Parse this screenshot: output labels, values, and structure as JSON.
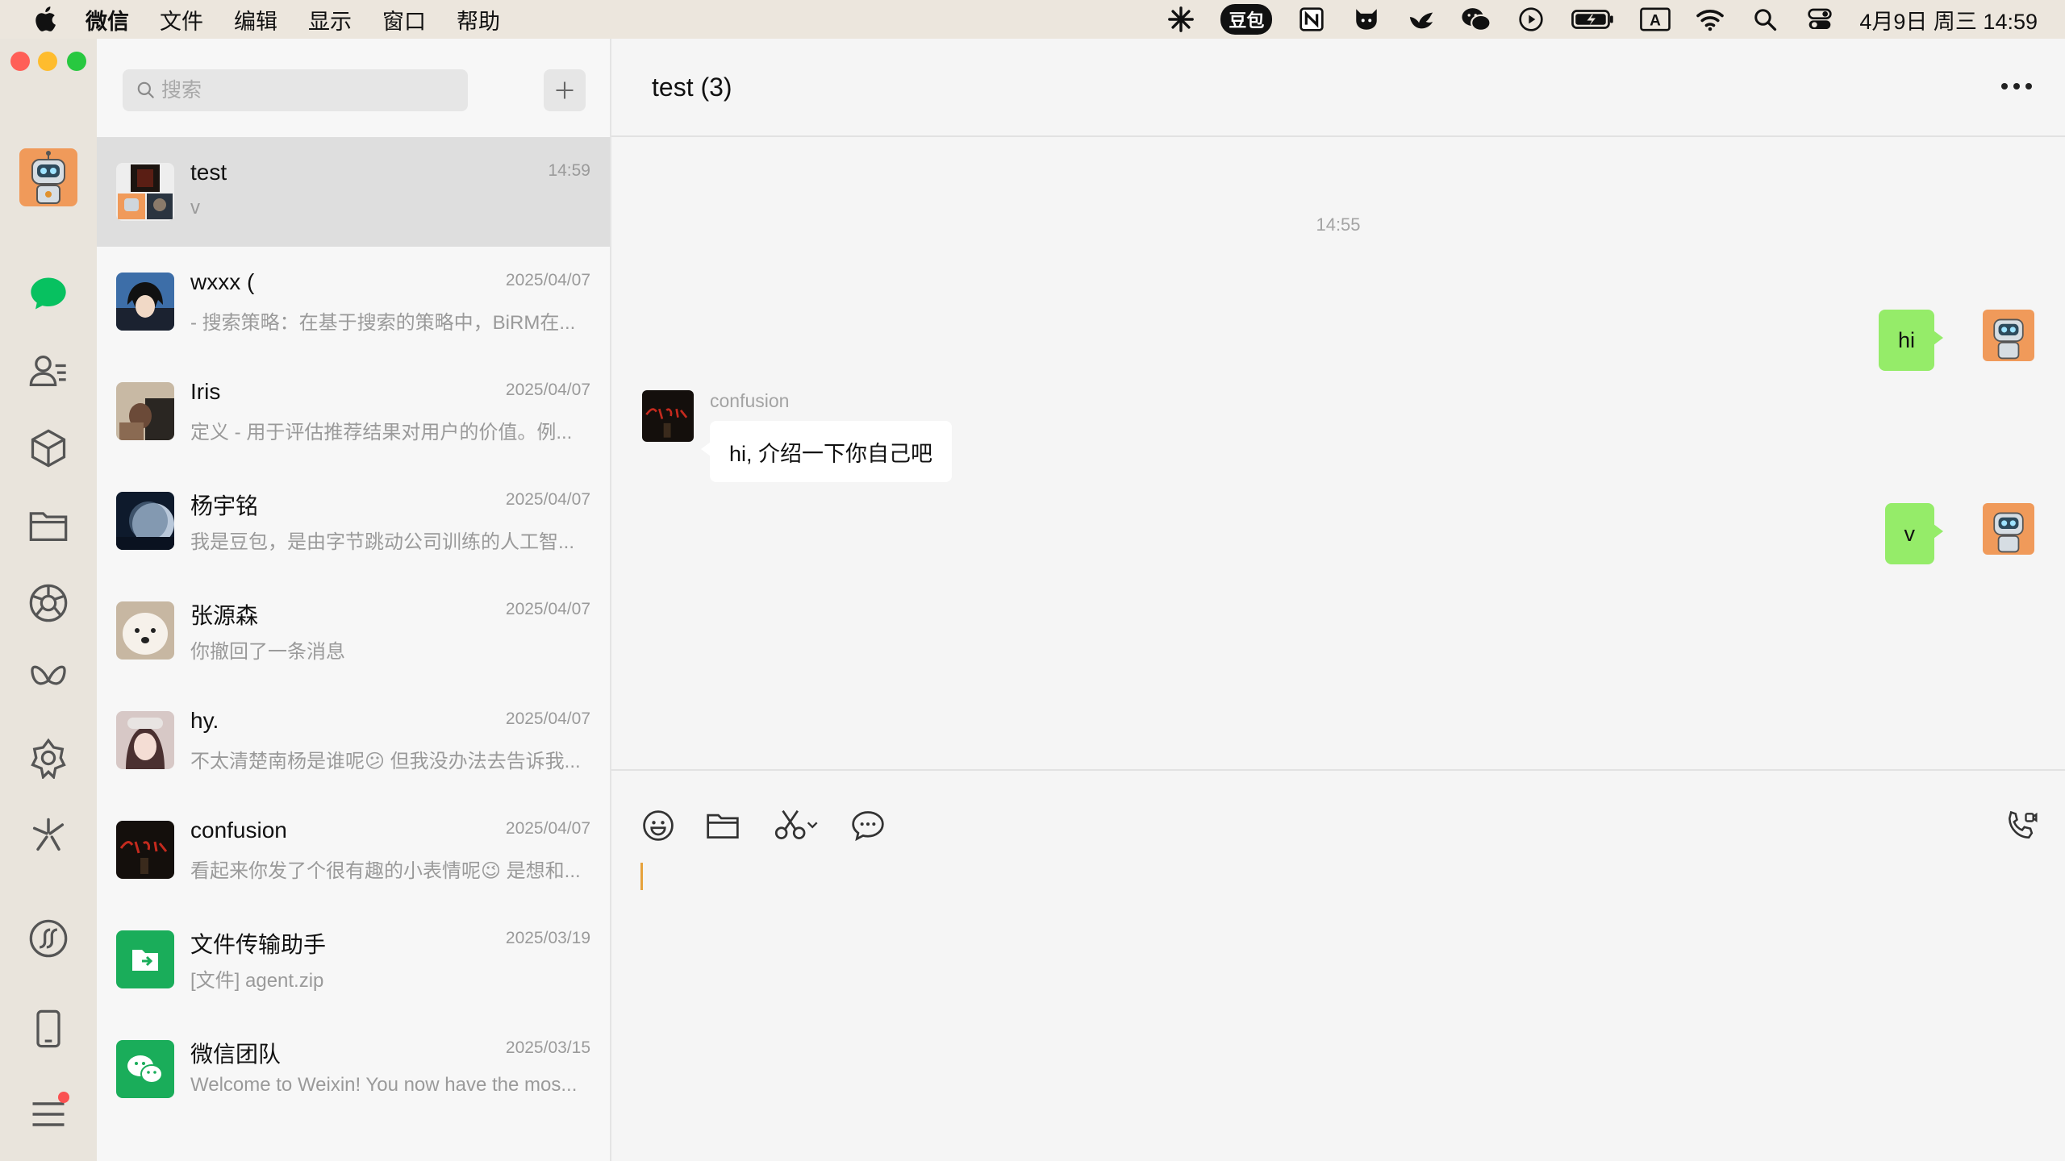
{
  "menubar": {
    "apple_icon": "apple-logo-icon",
    "items": [
      "微信",
      "文件",
      "编辑",
      "显示",
      "窗口",
      "帮助"
    ],
    "status_icons": [
      "sparkle-icon",
      "doubao-badge",
      "notion-icon",
      "cat-icon",
      "bird-icon",
      "wechat-icon",
      "play-icon",
      "battery-icon",
      "input-method-icon",
      "wifi-icon",
      "spotlight-icon",
      "control-center-icon"
    ],
    "doubao_label": "豆包",
    "input_method_label": "A",
    "clock": "4月9日 周三  14:59"
  },
  "sidebar": {
    "items": [
      "chat-icon",
      "contacts-icon",
      "favorites-icon",
      "files-icon",
      "moments-icon",
      "channels-icon",
      "mini-programs-icon",
      "search-icon",
      "apps-icon",
      "phone-icon",
      "menu-icon"
    ]
  },
  "search": {
    "placeholder": "搜索"
  },
  "chats": [
    {
      "name": "test",
      "time": "14:59",
      "preview": "v"
    },
    {
      "name": "wxxx (",
      "time": "2025/04/07",
      "preview": "- 搜索策略：在基于搜索的策略中，BiRM在..."
    },
    {
      "name": "Iris",
      "time": "2025/04/07",
      "preview": "定义  - 用于评估推荐结果对用户的价值。例..."
    },
    {
      "name": "杨宇铭",
      "time": "2025/04/07",
      "preview": "我是豆包，是由字节跳动公司训练的人工智..."
    },
    {
      "name": "张源森",
      "time": "2025/04/07",
      "preview": "你撤回了一条消息"
    },
    {
      "name": "hy.",
      "time": "2025/04/07",
      "preview": "不太清楚南杨是谁呢😕 但我没办法去告诉我..."
    },
    {
      "name": "confusion",
      "time": "2025/04/07",
      "preview": "看起来你发了个很有趣的小表情呢😉 是想和..."
    },
    {
      "name": "文件传输助手",
      "time": "2025/03/19",
      "preview": "[文件] agent.zip"
    },
    {
      "name": "微信团队",
      "time": "2025/03/15",
      "preview": "Welcome to Weixin! You now have the mos..."
    }
  ],
  "conversation": {
    "title": "test  (3)",
    "time_divider": "14:55",
    "messages": [
      {
        "from": "me",
        "text": "hi"
      },
      {
        "from": "other",
        "sender": "confusion",
        "text": "hi, 介绍一下你自己吧"
      },
      {
        "from": "me",
        "text": "v"
      }
    ]
  },
  "colors": {
    "accent_green": "#07c160",
    "bubble_me": "#95ec69",
    "bubble_other": "#ffffff",
    "badge_red": "#fa5151"
  }
}
